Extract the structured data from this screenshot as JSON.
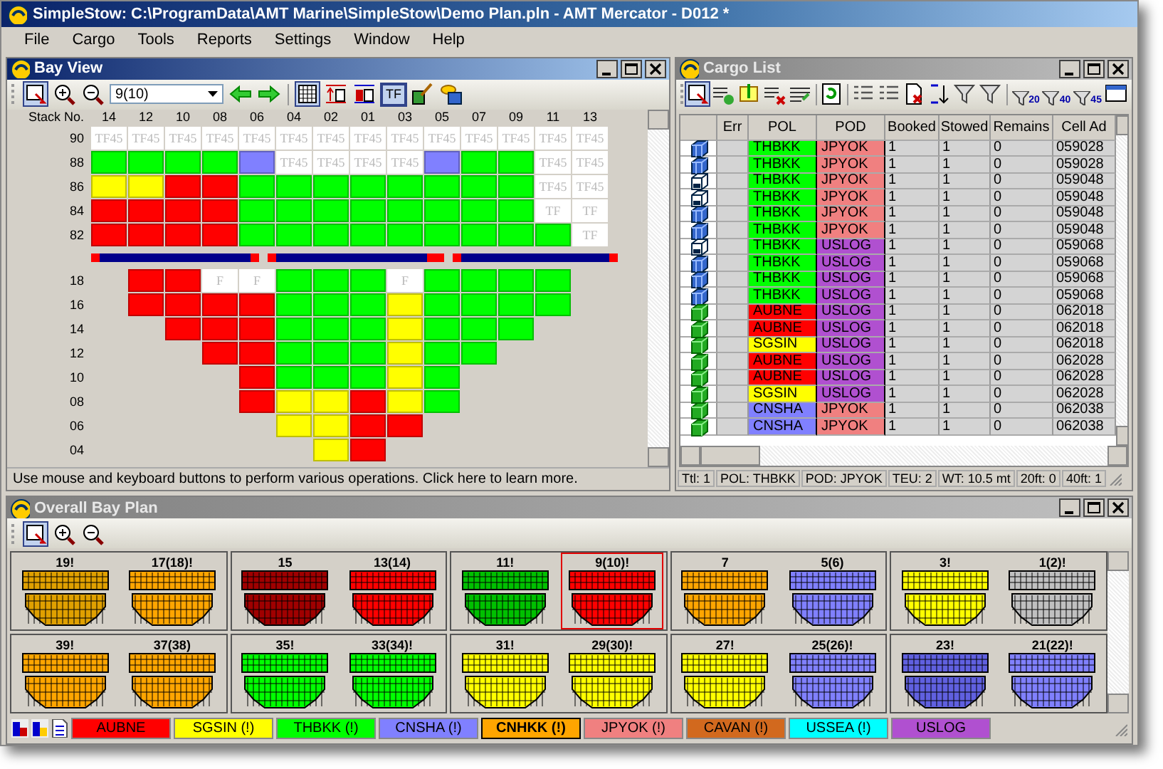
{
  "window": {
    "title": "SimpleStow: C:\\ProgramData\\AMT Marine\\SimpleStow\\Demo Plan.pln - AMT Mercator - D012 *"
  },
  "menu": [
    "File",
    "Cargo",
    "Tools",
    "Reports",
    "Settings",
    "Window",
    "Help"
  ],
  "bay_view": {
    "title": "Bay View",
    "bay_select": "9(10)",
    "tf_toggle": {
      "label": "TF",
      "on": true
    },
    "stack_label": "Stack No.",
    "stacks": [
      "14",
      "12",
      "10",
      "08",
      "06",
      "04",
      "02",
      "01",
      "03",
      "05",
      "07",
      "09",
      "11",
      "13"
    ],
    "deck": [
      {
        "tier": "90",
        "cells": [
          {
            "label": "TF45"
          },
          {
            "label": "TF45"
          },
          {
            "label": "TF45"
          },
          {
            "label": "TF45"
          },
          {
            "label": "TF45"
          },
          {
            "label": "TF45"
          },
          {
            "label": "TF45"
          },
          {
            "label": "TF45"
          },
          {
            "label": "TF45"
          },
          {
            "label": "TF45"
          },
          {
            "label": "TF45"
          },
          {
            "label": "TF45"
          },
          {
            "label": "TF45"
          },
          {
            "label": "TF45"
          }
        ]
      },
      {
        "tier": "88",
        "cells": [
          {
            "color": "#00ff00"
          },
          {
            "color": "#00ff00"
          },
          {
            "color": "#00ff00"
          },
          {
            "color": "#00ff00"
          },
          {
            "color": "#8080ff"
          },
          {
            "label": "TF45"
          },
          {
            "label": "TF45"
          },
          {
            "label": "TF45"
          },
          {
            "label": "TF45"
          },
          {
            "color": "#8080ff"
          },
          {
            "color": "#00ff00"
          },
          {
            "color": "#00ff00"
          },
          {
            "label": "TF45"
          },
          {
            "label": "TF45"
          }
        ]
      },
      {
        "tier": "86",
        "cells": [
          {
            "color": "#ffff00"
          },
          {
            "color": "#ffff00"
          },
          {
            "color": "#ff0000"
          },
          {
            "color": "#ff0000"
          },
          {
            "color": "#00ff00"
          },
          {
            "color": "#00ff00"
          },
          {
            "color": "#00ff00"
          },
          {
            "color": "#00ff00"
          },
          {
            "color": "#00ff00"
          },
          {
            "color": "#00ff00"
          },
          {
            "color": "#00ff00"
          },
          {
            "color": "#00ff00"
          },
          {
            "label": "TF45"
          },
          {
            "label": "TF45"
          }
        ]
      },
      {
        "tier": "84",
        "cells": [
          {
            "color": "#ff0000"
          },
          {
            "color": "#ff0000"
          },
          {
            "color": "#ff0000"
          },
          {
            "color": "#ff0000"
          },
          {
            "color": "#00ff00"
          },
          {
            "color": "#00ff00"
          },
          {
            "color": "#00ff00"
          },
          {
            "color": "#00ff00"
          },
          {
            "color": "#00ff00"
          },
          {
            "color": "#00ff00"
          },
          {
            "color": "#00ff00"
          },
          {
            "color": "#00ff00"
          },
          {
            "label": "TF"
          },
          {
            "label": "TF"
          }
        ]
      },
      {
        "tier": "82",
        "cells": [
          {
            "color": "#ff0000"
          },
          {
            "color": "#ff0000"
          },
          {
            "color": "#ff0000"
          },
          {
            "color": "#ff0000"
          },
          {
            "color": "#00ff00"
          },
          {
            "color": "#00ff00"
          },
          {
            "color": "#00ff00"
          },
          {
            "color": "#00ff00"
          },
          {
            "color": "#00ff00"
          },
          {
            "color": "#00ff00"
          },
          {
            "color": "#00ff00"
          },
          {
            "color": "#00ff00"
          },
          {
            "color": "#00ff00"
          },
          {
            "label": "TF"
          }
        ]
      }
    ],
    "hold": [
      {
        "tier": "18",
        "cells": [
          null,
          {
            "color": "#ff0000"
          },
          {
            "color": "#ff0000"
          },
          {
            "label": "F"
          },
          {
            "label": "F"
          },
          {
            "color": "#00ff00"
          },
          {
            "color": "#00ff00"
          },
          {
            "color": "#00ff00"
          },
          {
            "label": "F"
          },
          {
            "color": "#00ff00"
          },
          {
            "color": "#00ff00"
          },
          {
            "color": "#00ff00"
          },
          {
            "color": "#00ff00"
          }
        ]
      },
      {
        "tier": "16",
        "cells": [
          null,
          {
            "color": "#ff0000"
          },
          {
            "color": "#ff0000"
          },
          {
            "color": "#ff0000"
          },
          {
            "color": "#ff0000"
          },
          {
            "color": "#00ff00"
          },
          {
            "color": "#00ff00"
          },
          {
            "color": "#00ff00"
          },
          {
            "color": "#ffff00"
          },
          {
            "color": "#00ff00"
          },
          {
            "color": "#00ff00"
          },
          {
            "color": "#00ff00"
          },
          {
            "color": "#00ff00"
          }
        ]
      },
      {
        "tier": "14",
        "cells": [
          null,
          null,
          {
            "color": "#ff0000"
          },
          {
            "color": "#ff0000"
          },
          {
            "color": "#ff0000"
          },
          {
            "color": "#00ff00"
          },
          {
            "color": "#00ff00"
          },
          {
            "color": "#00ff00"
          },
          {
            "color": "#ffff00"
          },
          {
            "color": "#00ff00"
          },
          {
            "color": "#00ff00"
          },
          {
            "color": "#00ff00"
          }
        ]
      },
      {
        "tier": "12",
        "cells": [
          null,
          null,
          null,
          {
            "color": "#ff0000"
          },
          {
            "color": "#ff0000"
          },
          {
            "color": "#00ff00"
          },
          {
            "color": "#00ff00"
          },
          {
            "color": "#00ff00"
          },
          {
            "color": "#ffff00"
          },
          {
            "color": "#00ff00"
          },
          {
            "color": "#00ff00"
          }
        ]
      },
      {
        "tier": "10",
        "cells": [
          null,
          null,
          null,
          null,
          {
            "color": "#ff0000"
          },
          {
            "color": "#00ff00"
          },
          {
            "color": "#00ff00"
          },
          {
            "color": "#00ff00"
          },
          {
            "color": "#ffff00"
          },
          {
            "color": "#00ff00"
          }
        ]
      },
      {
        "tier": "08",
        "cells": [
          null,
          null,
          null,
          null,
          {
            "color": "#ff0000"
          },
          {
            "color": "#ffff00"
          },
          {
            "color": "#ffff00"
          },
          {
            "color": "#ff0000"
          },
          {
            "color": "#ffff00"
          },
          {
            "color": "#00ff00"
          }
        ]
      },
      {
        "tier": "06",
        "cells": [
          null,
          null,
          null,
          null,
          null,
          {
            "color": "#ffff00"
          },
          {
            "color": "#ffff00"
          },
          {
            "color": "#ff0000"
          },
          {
            "color": "#ff0000"
          }
        ]
      },
      {
        "tier": "04",
        "cells": [
          null,
          null,
          null,
          null,
          null,
          null,
          {
            "color": "#ffff00"
          },
          {
            "color": "#ff0000"
          }
        ]
      }
    ],
    "hint": "Use mouse and keyboard buttons to perform various operations. Click here to learn more."
  },
  "cargo_list": {
    "title": "Cargo List",
    "filters": [
      "20",
      "40",
      "45"
    ],
    "columns": [
      "Err",
      "POL",
      "POD",
      "Booked",
      "Stowed",
      "Remains",
      "Cell Ad"
    ],
    "rows": [
      {
        "kind": "blue",
        "pol": {
          "text": "THBKK",
          "color": "#00ff00"
        },
        "pod": {
          "text": "JPYOK",
          "color": "#f08080"
        },
        "booked": "1",
        "stowed": "1",
        "remains": "0",
        "cell": "059028"
      },
      {
        "kind": "blue",
        "pol": {
          "text": "THBKK",
          "color": "#00ff00"
        },
        "pod": {
          "text": "JPYOK",
          "color": "#f08080"
        },
        "booked": "1",
        "stowed": "1",
        "remains": "0",
        "cell": "059028"
      },
      {
        "kind": "outline",
        "pol": {
          "text": "THBKK",
          "color": "#00ff00"
        },
        "pod": {
          "text": "JPYOK",
          "color": "#f08080"
        },
        "booked": "1",
        "stowed": "1",
        "remains": "0",
        "cell": "059048"
      },
      {
        "kind": "outline",
        "pol": {
          "text": "THBKK",
          "color": "#00ff00"
        },
        "pod": {
          "text": "JPYOK",
          "color": "#f08080"
        },
        "booked": "1",
        "stowed": "1",
        "remains": "0",
        "cell": "059048"
      },
      {
        "kind": "blue",
        "pol": {
          "text": "THBKK",
          "color": "#00ff00"
        },
        "pod": {
          "text": "JPYOK",
          "color": "#f08080"
        },
        "booked": "1",
        "stowed": "1",
        "remains": "0",
        "cell": "059048"
      },
      {
        "kind": "blue",
        "pol": {
          "text": "THBKK",
          "color": "#00ff00"
        },
        "pod": {
          "text": "JPYOK",
          "color": "#f08080"
        },
        "booked": "1",
        "stowed": "1",
        "remains": "0",
        "cell": "059048"
      },
      {
        "kind": "outline",
        "pol": {
          "text": "THBKK",
          "color": "#00ff00"
        },
        "pod": {
          "text": "USLOG",
          "color": "#b050d0"
        },
        "booked": "1",
        "stowed": "1",
        "remains": "0",
        "cell": "059068"
      },
      {
        "kind": "blue",
        "pol": {
          "text": "THBKK",
          "color": "#00ff00"
        },
        "pod": {
          "text": "USLOG",
          "color": "#b050d0"
        },
        "booked": "1",
        "stowed": "1",
        "remains": "0",
        "cell": "059068"
      },
      {
        "kind": "blue",
        "pol": {
          "text": "THBKK",
          "color": "#00ff00"
        },
        "pod": {
          "text": "USLOG",
          "color": "#b050d0"
        },
        "booked": "1",
        "stowed": "1",
        "remains": "0",
        "cell": "059068"
      },
      {
        "kind": "blue",
        "pol": {
          "text": "THBKK",
          "color": "#00ff00"
        },
        "pod": {
          "text": "USLOG",
          "color": "#b050d0"
        },
        "booked": "1",
        "stowed": "1",
        "remains": "0",
        "cell": "059068"
      },
      {
        "kind": "green",
        "pol": {
          "text": "AUBNE",
          "color": "#ff0000"
        },
        "pod": {
          "text": "USLOG",
          "color": "#b050d0"
        },
        "booked": "1",
        "stowed": "1",
        "remains": "0",
        "cell": "062018"
      },
      {
        "kind": "green",
        "pol": {
          "text": "AUBNE",
          "color": "#ff0000"
        },
        "pod": {
          "text": "USLOG",
          "color": "#b050d0"
        },
        "booked": "1",
        "stowed": "1",
        "remains": "0",
        "cell": "062018"
      },
      {
        "kind": "green",
        "pol": {
          "text": "SGSIN",
          "color": "#ffff00"
        },
        "pod": {
          "text": "USLOG",
          "color": "#b050d0"
        },
        "booked": "1",
        "stowed": "1",
        "remains": "0",
        "cell": "062018"
      },
      {
        "kind": "green",
        "pol": {
          "text": "AUBNE",
          "color": "#ff0000"
        },
        "pod": {
          "text": "USLOG",
          "color": "#b050d0"
        },
        "booked": "1",
        "stowed": "1",
        "remains": "0",
        "cell": "062028"
      },
      {
        "kind": "green",
        "pol": {
          "text": "AUBNE",
          "color": "#ff0000"
        },
        "pod": {
          "text": "USLOG",
          "color": "#b050d0"
        },
        "booked": "1",
        "stowed": "1",
        "remains": "0",
        "cell": "062028"
      },
      {
        "kind": "green",
        "pol": {
          "text": "SGSIN",
          "color": "#ffff00"
        },
        "pod": {
          "text": "USLOG",
          "color": "#b050d0"
        },
        "booked": "1",
        "stowed": "1",
        "remains": "0",
        "cell": "062028"
      },
      {
        "kind": "green",
        "pol": {
          "text": "CNSHA",
          "color": "#8080ff"
        },
        "pod": {
          "text": "JPYOK",
          "color": "#f08080"
        },
        "booked": "1",
        "stowed": "1",
        "remains": "0",
        "cell": "062038"
      },
      {
        "kind": "green",
        "pol": {
          "text": "CNSHA",
          "color": "#8080ff"
        },
        "pod": {
          "text": "JPYOK",
          "color": "#f08080"
        },
        "booked": "1",
        "stowed": "1",
        "remains": "0",
        "cell": "062038"
      }
    ],
    "status": [
      "Ttl: 1",
      "POL: THBKK",
      "POD: JPYOK",
      "TEU: 2",
      "WT: 10.5 mt",
      "20ft: 0",
      "40ft: 1"
    ]
  },
  "overall_bay_plan": {
    "title": "Overall Bay Plan",
    "rows": [
      [
        {
          "bays": [
            {
              "label": "19!",
              "color": "#e0a000",
              "selected": false
            },
            {
              "label": "17(18)!",
              "color": "#ffa500",
              "selected": false
            }
          ]
        },
        {
          "bays": [
            {
              "label": "15",
              "color": "#a00000",
              "selected": false
            },
            {
              "label": "13(14)",
              "color": "#ff0000",
              "selected": false
            }
          ]
        },
        {
          "bays": [
            {
              "label": "11!",
              "color": "#00c000",
              "selected": false
            },
            {
              "label": "9(10)!",
              "color": "#ff0000",
              "selected": true
            }
          ]
        },
        {
          "bays": [
            {
              "label": "7",
              "color": "#ffa500",
              "selected": false
            },
            {
              "label": "5(6)",
              "color": "#8080ff",
              "selected": false
            }
          ]
        },
        {
          "bays": [
            {
              "label": "3!",
              "color": "#ffff00",
              "selected": false
            },
            {
              "label": "1(2)!",
              "color": "#c0c0c0",
              "selected": false
            }
          ]
        }
      ],
      [
        {
          "bays": [
            {
              "label": "39!",
              "color": "#ffa500",
              "selected": false
            },
            {
              "label": "37(38)",
              "color": "#ffa500",
              "selected": false
            }
          ]
        },
        {
          "bays": [
            {
              "label": "35!",
              "color": "#00ff00",
              "selected": false
            },
            {
              "label": "33(34)!",
              "color": "#00ff00",
              "selected": false
            }
          ]
        },
        {
          "bays": [
            {
              "label": "31!",
              "color": "#ffff00",
              "selected": false
            },
            {
              "label": "29(30)!",
              "color": "#ffff00",
              "selected": false
            }
          ]
        },
        {
          "bays": [
            {
              "label": "27!",
              "color": "#ffff00",
              "selected": false
            },
            {
              "label": "25(26)!",
              "color": "#8080ff",
              "selected": false
            }
          ]
        },
        {
          "bays": [
            {
              "label": "23!",
              "color": "#6060e0",
              "selected": false
            },
            {
              "label": "21(22)!",
              "color": "#8080ff",
              "selected": false
            }
          ]
        }
      ]
    ]
  },
  "legend": [
    {
      "label": "AUBNE",
      "color": "#ff0000",
      "selected": false
    },
    {
      "label": "SGSIN (!)",
      "color": "#ffff00",
      "selected": false
    },
    {
      "label": "THBKK (!)",
      "color": "#00ff00",
      "selected": false
    },
    {
      "label": "CNSHA (!)",
      "color": "#8080ff",
      "selected": false
    },
    {
      "label": "CNHKK (!)",
      "color": "#ffa500",
      "selected": true
    },
    {
      "label": "JPYOK (!)",
      "color": "#f08080",
      "selected": false
    },
    {
      "label": "CAVAN (!)",
      "color": "#d2691e",
      "selected": false
    },
    {
      "label": "USSEA (!)",
      "color": "#00ffff",
      "selected": false
    },
    {
      "label": "USLOG",
      "color": "#b050d0",
      "selected": false
    }
  ]
}
